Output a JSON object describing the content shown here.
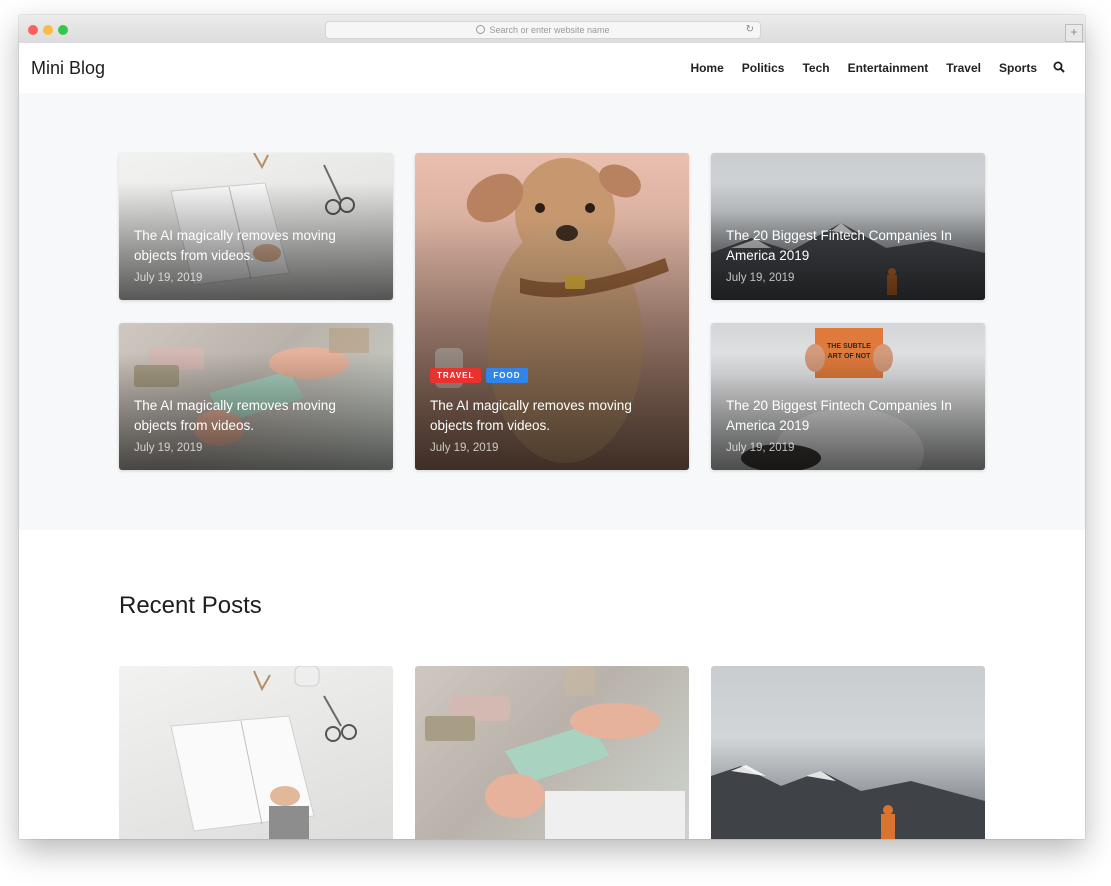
{
  "browser": {
    "address_placeholder": "Search or enter website name",
    "newtab_symbol": "+"
  },
  "site": {
    "logo": "Mini Blog",
    "nav": [
      "Home",
      "Politics",
      "Tech",
      "Entertainment",
      "Travel",
      "Sports"
    ]
  },
  "featured": [
    {
      "title": "The AI magically removes moving objects from videos.",
      "date": "July 19, 2019",
      "image": "notebook-desk"
    },
    {
      "title": "The AI magically removes moving objects from videos.",
      "date": "July 19, 2019",
      "image": "dog-portrait",
      "tags": [
        "TRAVEL",
        "FOOD"
      ]
    },
    {
      "title": "The 20 Biggest Fintech Companies In America 2019",
      "date": "July 19, 2019",
      "image": "misty-mountain"
    },
    {
      "title": "The AI magically removes moving objects from videos.",
      "date": "July 19, 2019",
      "image": "hands-box"
    },
    {
      "title": "The 20 Biggest Fintech Companies In America 2019",
      "date": "July 19, 2019",
      "image": "man-reading-book"
    }
  ],
  "recent": {
    "heading": "Recent Posts",
    "images": [
      "notebook-desk",
      "hands-box",
      "misty-mountain"
    ]
  },
  "colors": {
    "tag_travel": "#e8322f",
    "tag_food": "#2f86e8",
    "hero_bg": "#f7f8f9"
  }
}
